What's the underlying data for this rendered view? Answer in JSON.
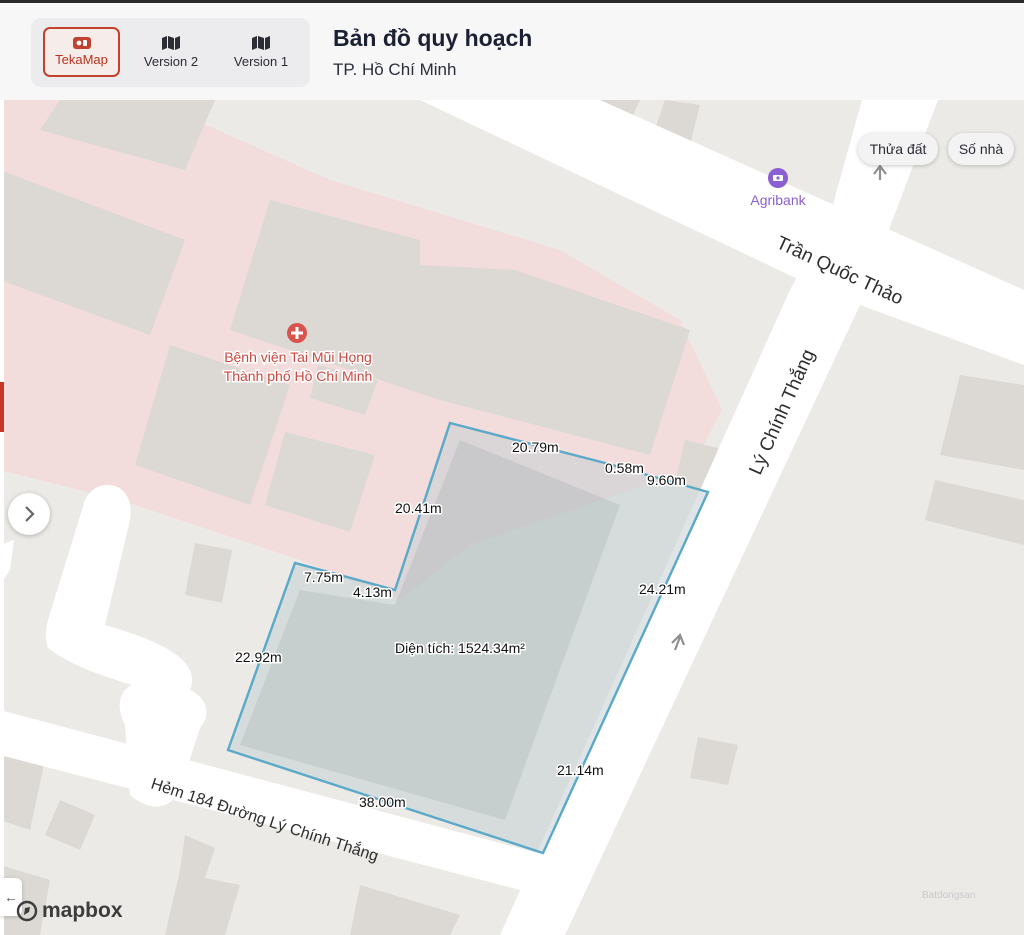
{
  "header": {
    "title": "Bản đồ quy hoạch",
    "subtitle": "TP. Hồ Chí Minh",
    "versions": [
      {
        "label": "TekaMap",
        "icon": "tekamap-logo-icon",
        "active": true
      },
      {
        "label": "Version 2",
        "icon": "map-icon",
        "active": false
      },
      {
        "label": "Version 1",
        "icon": "map-icon",
        "active": false
      }
    ]
  },
  "map_controls": {
    "parcel_button": "Thửa đất",
    "house_number_button": "Số nhà"
  },
  "places": {
    "bank": "Agribank",
    "hospital_line1": "Bệnh viện Tai Mũi Họng",
    "hospital_line2": "Thành phố Hồ Chí Minh"
  },
  "streets": {
    "tran_quoc_thao": "Trần Quốc Thảo",
    "ly_chinh_thang": "Lý Chính Thắng",
    "hem_184": "Hẻm 184 Đường Lý Chính Thắng"
  },
  "parcel": {
    "area_label": "Diện tích: 1524.34m²",
    "edges": [
      "20.79m",
      "0.58m",
      "9.60m",
      "24.21m",
      "21.14m",
      "38.00m",
      "22.92m",
      "7.75m",
      "4.13m",
      "20.41m"
    ]
  },
  "branding": {
    "mapbox": "mapbox",
    "watermark": "Batdongsan"
  },
  "colors": {
    "accent": "#c2412f",
    "parcel_outline": "#5aa9c9",
    "hospital_zone": "#f5dcdc",
    "poi_purple": "#8a5fd1",
    "hospital_red": "#d9534f"
  }
}
